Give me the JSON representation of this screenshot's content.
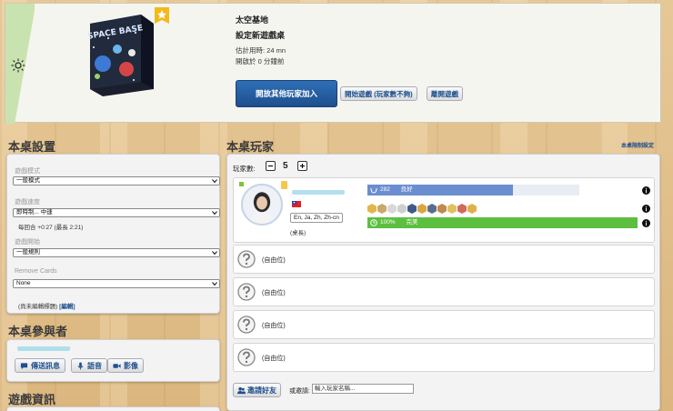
{
  "game": {
    "title": "太空基地",
    "subtitle": "設定新遊戲桌",
    "est_time": "估計用時:   24 mn",
    "started": "開啟於 0 分鐘前",
    "box_text": "SPACE BASE"
  },
  "actions": {
    "open_to_players": "開放其他玩家加入",
    "start_game": "開始遊戲 (玩家數不夠)",
    "leave_game": "離開遊戲"
  },
  "table_settings": {
    "heading": "本桌設置",
    "game_mode_label": "遊戲模式",
    "game_mode_value": "一般模式",
    "speed_label": "遊戲速度",
    "speed_value": "即時制... 中速",
    "speed_note": "每回合 +0:27 (最長 2:21)",
    "start_label": "遊戲開始",
    "start_value": "一般規則",
    "remove_cards_label": "Remove Cards",
    "remove_cards_value": "None",
    "untitled_note": "(尚未編輯標題)",
    "edit_link": "[編輯]"
  },
  "participants": {
    "heading": "本桌參與者",
    "send_message": "傳送訊息",
    "voice": "語音",
    "video": "影像"
  },
  "game_info": {
    "heading": "遊戲資訊"
  },
  "players": {
    "heading": "本桌玩家",
    "table_settings_link": "本桌限制設定",
    "count_label": "玩家數:",
    "count": "5",
    "host": {
      "languages": "En, Ja, Zh, Zh-cn",
      "role": "(桌長)",
      "elo": "282",
      "elo_label": "良好",
      "elo_fraction": 0.55,
      "reliability": "100%",
      "reliability_label": "完美",
      "reliability_fraction": 1.0
    },
    "free_seat_label": "(自由位)",
    "free_seats": 4,
    "invite_button": "邀請好友",
    "invite_or": "或邀請:",
    "invite_placeholder": "輸入玩家名稱..."
  },
  "colors": {
    "primary_blue": "#1d4f8e",
    "elo_blue": "#6a8ed0",
    "reliability_green": "#5cbf3f",
    "banner_green": "#c9e3b0"
  }
}
